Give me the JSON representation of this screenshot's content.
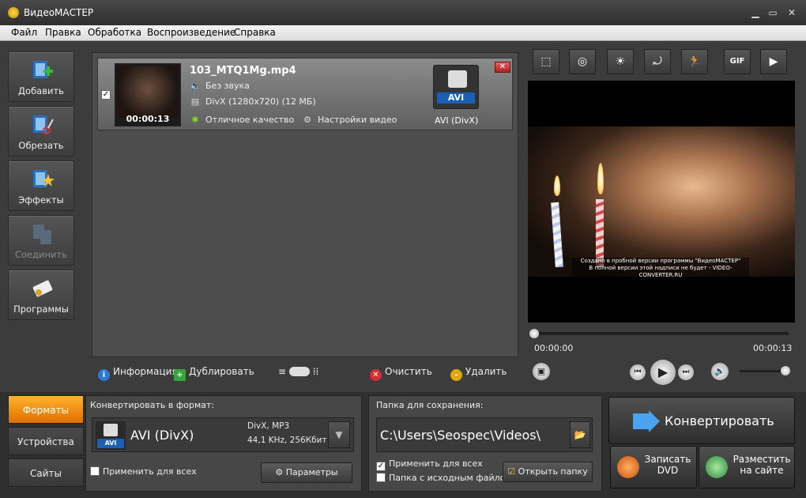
{
  "app": {
    "title": "ВидеоМАСТЕР"
  },
  "menu": [
    "Файл",
    "Правка",
    "Обработка",
    "Воспроизведение",
    "Справка"
  ],
  "sidebar": {
    "items": [
      {
        "label": "Добавить",
        "icon": "add-video-icon"
      },
      {
        "label": "Обрезать",
        "icon": "cut-icon"
      },
      {
        "label": "Эффекты",
        "icon": "effects-icon"
      },
      {
        "label": "Соединить",
        "icon": "join-icon",
        "disabled": true
      },
      {
        "label": "Программы",
        "icon": "programs-icon"
      }
    ]
  },
  "file": {
    "name": "103_MTQ1Mg.mp4",
    "duration": "00:00:13",
    "audio": "Без звука",
    "video": "DivX (1280x720) (12 МБ)",
    "quality": "Отличное качество",
    "settings": "Настройки видео",
    "format_tag": "AVI",
    "format_label": "AVI (DivX)"
  },
  "listbar": {
    "info": "Информация",
    "duplicate": "Дублировать",
    "clear": "Очистить",
    "delete": "Удалить"
  },
  "player": {
    "time_start": "00:00:00",
    "time_end": "00:00:13",
    "watermark_line1": "Создано в пробной версии программы \"ВидеоМАСТЕР\"",
    "watermark_line2": "В полной версии этой надписи не будет - VIDEO-CONVERTER.RU",
    "gif_label": "GIF",
    "progress": 0.0,
    "volume": 1.0
  },
  "tabs": [
    "Форматы",
    "Устройства",
    "Сайты"
  ],
  "format_panel": {
    "title": "Конвертировать в формат:",
    "format": "AVI (DivX)",
    "format_tag": "AVI",
    "codec": "DivX, MP3",
    "audio": "44,1 KHz, 256Кбит",
    "apply_all": "Применить для всех",
    "params": "Параметры"
  },
  "save_panel": {
    "title": "Папка для сохранения:",
    "path": "C:\\Users\\Seospec\\Videos\\",
    "apply_all": "Применить для всех",
    "source_folder": "Папка с исходным файлом",
    "open_folder": "Открыть папку"
  },
  "actions": {
    "convert": "Конвертировать",
    "burn_dvd": "Записать\nDVD",
    "publish": "Разместить\nна сайте"
  },
  "colors": {
    "accent": "#f08a00",
    "format_badge": "#1a5fb4"
  }
}
